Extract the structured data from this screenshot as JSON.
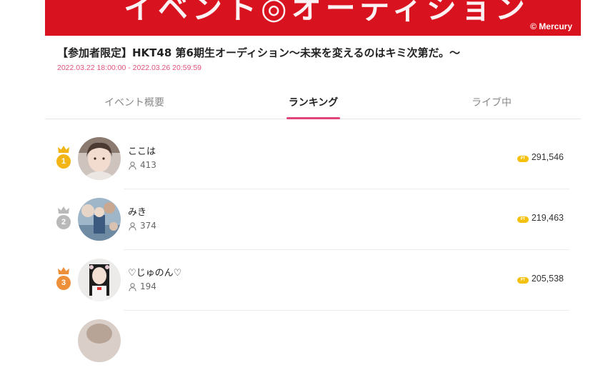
{
  "banner": {
    "art_text": "イベント◎オーディション",
    "copyright": "© Mercury"
  },
  "event": {
    "title": "【参加者限定】HKT48 第6期生オーディション～未来を変えるのはキミ次第だ。～",
    "period": "2022.03.22 18:00:00 - 2022.03.26 20:59:59"
  },
  "tabs": [
    {
      "label": "イベント概要",
      "active": false
    },
    {
      "label": "ランキング",
      "active": true
    },
    {
      "label": "ライブ中",
      "active": false
    }
  ],
  "ranking": [
    {
      "rank": "1",
      "name": "ここは",
      "fans": "413",
      "points": "291,546",
      "medal": "gold"
    },
    {
      "rank": "2",
      "name": "みき",
      "fans": "374",
      "points": "219,463",
      "medal": "silver"
    },
    {
      "rank": "3",
      "name": "♡じゅのん♡",
      "fans": "194",
      "points": "205,538",
      "medal": "bronze"
    }
  ],
  "colors": {
    "banner": "#d8121f",
    "accent": "#e0457b",
    "gold": "#f2b515",
    "silver": "#b9b9b9",
    "bronze": "#ee8f3a",
    "points_icon": "#f4c20d"
  },
  "icons": {
    "crown": "crown-icon",
    "fans": "user-icon",
    "points": "pt-coin-icon"
  },
  "points_icon_text": "PT"
}
